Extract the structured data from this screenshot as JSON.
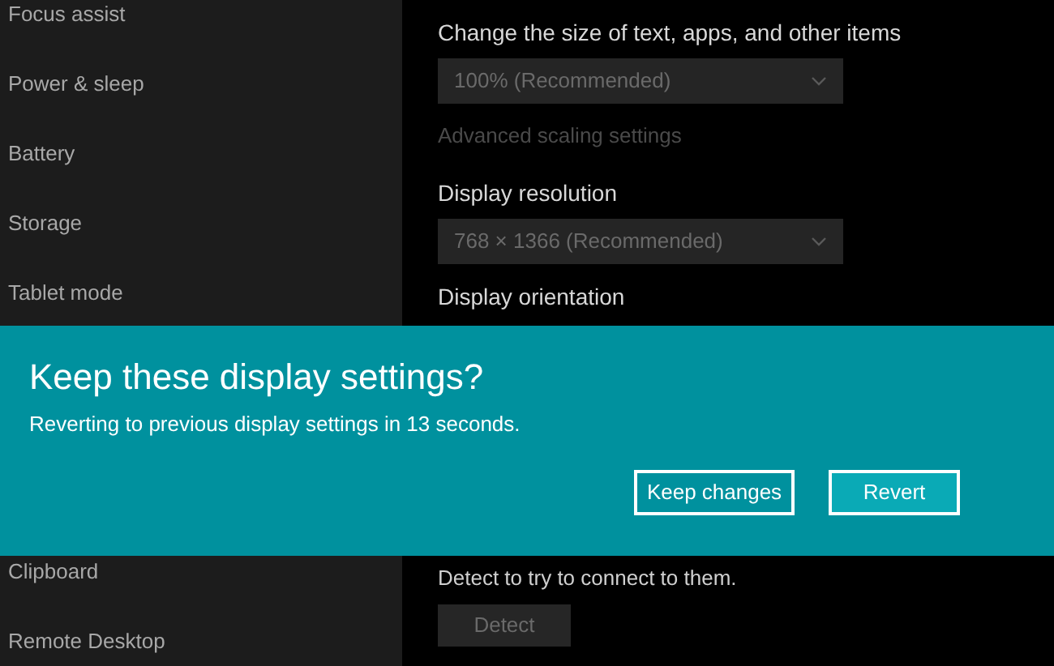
{
  "sidebar": {
    "items": [
      {
        "label": "Focus assist"
      },
      {
        "label": "Power & sleep"
      },
      {
        "label": "Battery"
      },
      {
        "label": "Storage"
      },
      {
        "label": "Tablet mode"
      }
    ],
    "items_below": [
      {
        "label": "Clipboard"
      },
      {
        "label": "Remote Desktop"
      }
    ]
  },
  "scale": {
    "heading": "Change the size of text, apps, and other items",
    "dropdown": {
      "value": "100% (Recommended)",
      "disabled": true
    },
    "link": {
      "label": "Advanced scaling settings",
      "disabled": true
    }
  },
  "resolution": {
    "heading": "Display resolution",
    "dropdown": {
      "value": "768 × 1366 (Recommended)",
      "disabled": true
    }
  },
  "orientation": {
    "heading": "Display orientation"
  },
  "multiple_displays": {
    "text": "Detect to try to connect to them.",
    "button": {
      "label": "Detect",
      "disabled": true
    }
  },
  "dialog": {
    "title": "Keep these display settings?",
    "message": "Reverting to previous display settings in 13 seconds.",
    "buttons": [
      {
        "label": "Keep changes",
        "kind": "secondary"
      },
      {
        "label": "Revert",
        "kind": "primary"
      }
    ]
  }
}
